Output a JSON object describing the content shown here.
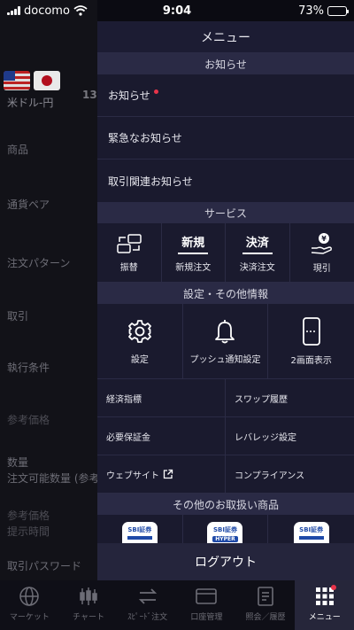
{
  "status": {
    "carrier": "docomo",
    "time": "9:04",
    "battery": "73%",
    "battery_level": 0.73
  },
  "background": {
    "pair": "米ドル-円",
    "rate_partial": "13",
    "rows": [
      "商品",
      "通貨ペア",
      "注文パターン",
      "取引",
      "執行条件",
      "参考価格",
      "数量",
      "注文可能数量 (参考",
      "参考価格",
      "提示時間",
      "取引パスワード"
    ]
  },
  "menu": {
    "title": "メニュー",
    "news": {
      "header": "お知らせ",
      "items": [
        "お知らせ",
        "緊急なお知らせ",
        "取引関連お知らせ"
      ]
    },
    "services": {
      "header": "サービス",
      "items": [
        {
          "label": "振替",
          "icon": "transfer-icon"
        },
        {
          "label": "新規注文",
          "icon_text": "新規"
        },
        {
          "label": "決済注文",
          "icon_text": "決済"
        },
        {
          "label": "現引",
          "icon": "yen-hand-icon",
          "glyph": "¥"
        }
      ]
    },
    "settings": {
      "header": "設定・その他情報",
      "items": [
        {
          "label": "設定",
          "icon": "gear-icon"
        },
        {
          "label": "プッシュ通知設定",
          "icon": "bell-icon"
        },
        {
          "label": "2画面表示",
          "icon": "phone-split-icon"
        }
      ],
      "links": [
        "経済指標",
        "スワップ履歴",
        "必要保証金",
        "レバレッジ設定",
        "ウェブサイト",
        "コンプライアンス"
      ]
    },
    "products": {
      "header": "その他のお取扱い商品",
      "brand": "SBI証券",
      "hyper_label": "HYPER"
    },
    "logout": "ログアウト"
  },
  "tabbar": {
    "tabs": [
      {
        "label": "マーケット",
        "icon": "globe-icon"
      },
      {
        "label": "チャート",
        "icon": "candlestick-icon"
      },
      {
        "label": "ｽﾋﾟｰﾄﾞ注文",
        "icon": "arrows-icon"
      },
      {
        "label": "口座管理",
        "icon": "wallet-icon"
      },
      {
        "label": "照会／履歴",
        "icon": "document-icon"
      },
      {
        "label": "メニュー",
        "icon": "grid-icon",
        "active": true
      }
    ]
  },
  "colors": {
    "panel": "#1a1a2e",
    "section": "#2a2a45",
    "badge": "#e8344a",
    "brand_blue": "#1f4aa8"
  }
}
